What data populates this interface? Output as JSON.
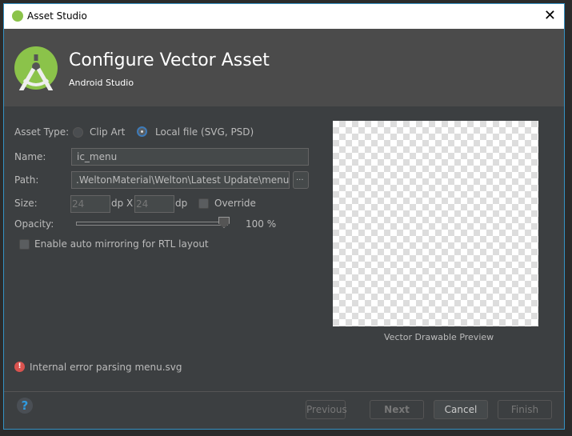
{
  "window": {
    "title": "Asset Studio"
  },
  "header": {
    "title": "Configure Vector Asset",
    "subtitle": "Android Studio"
  },
  "form": {
    "asset_type_label": "Asset Type:",
    "asset_type_options": [
      {
        "label": "Clip Art",
        "selected": false
      },
      {
        "label": "Local file (SVG, PSD)",
        "selected": true
      }
    ],
    "name_label": "Name:",
    "name_value": "ic_menu",
    "path_label": "Path:",
    "path_value": ".WeltonMaterial\\Welton\\Latest Update\\menu.svg",
    "browse_label": "...",
    "size_label": "Size:",
    "width_value": "24",
    "height_value": "24",
    "unit": "dp",
    "x_label": "X",
    "override_label": "Override",
    "override_checked": false,
    "opacity_label": "Opacity:",
    "opacity_value": 100,
    "opacity_text": "100 %",
    "rtl_label": "Enable auto mirroring for RTL layout",
    "rtl_checked": false
  },
  "preview": {
    "caption": "Vector Drawable Preview"
  },
  "error": {
    "message": "Internal error parsing menu.svg"
  },
  "footer": {
    "help": "?",
    "previous": "Previous",
    "next": "Next",
    "cancel": "Cancel",
    "finish": "Finish"
  }
}
